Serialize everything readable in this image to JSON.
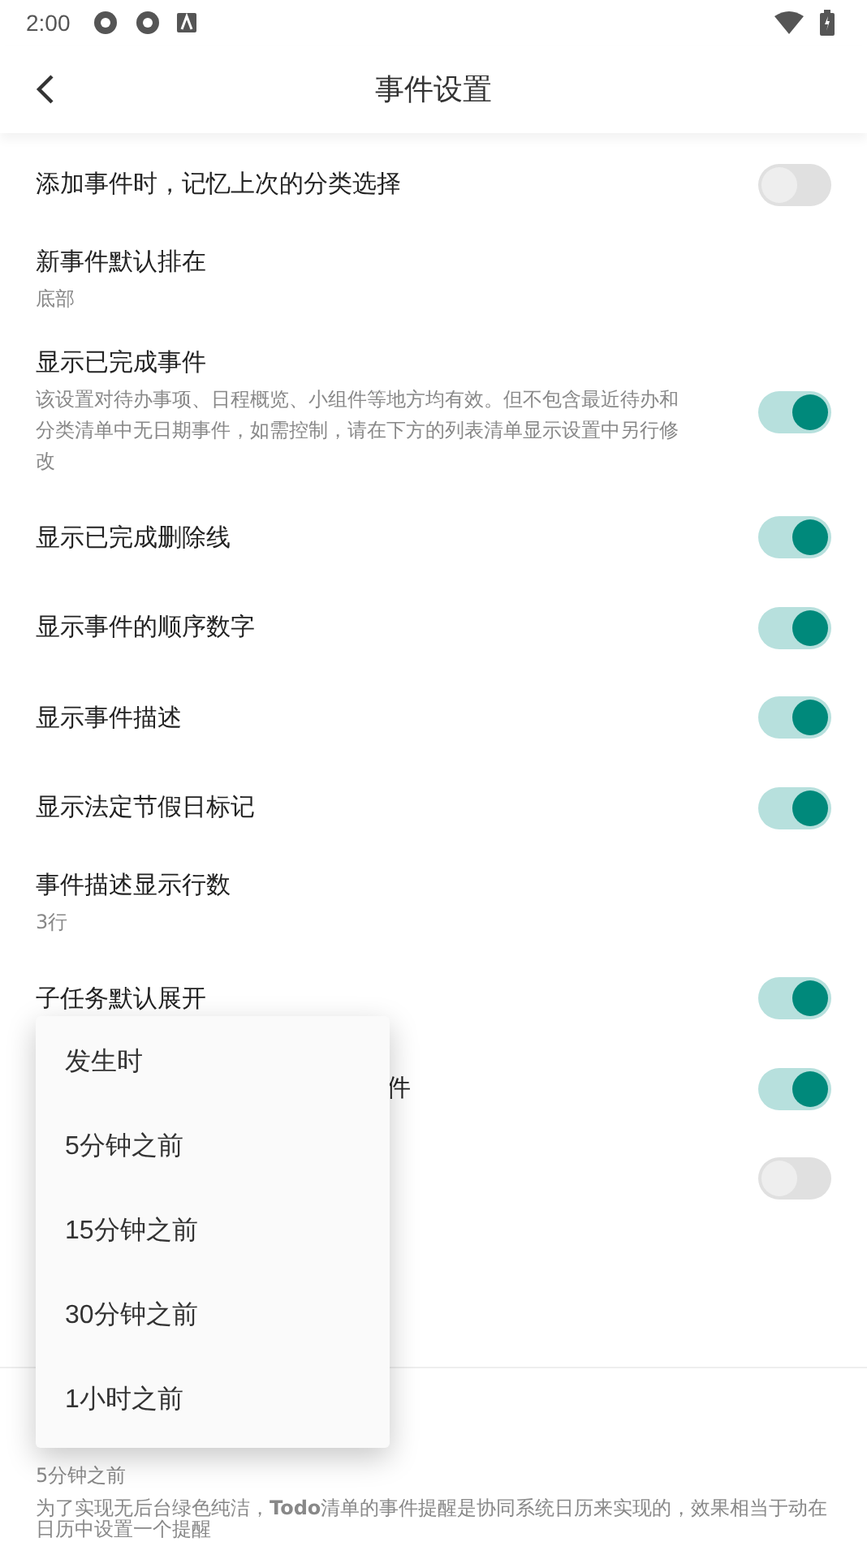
{
  "status_bar": {
    "time": "2:00"
  },
  "header": {
    "title": "事件设置"
  },
  "settings": [
    {
      "kind": "switch",
      "title": "添加事件时，记忆上次的分类选择",
      "on": false
    },
    {
      "kind": "value",
      "title": "新事件默认排在",
      "subtitle": "底部"
    },
    {
      "kind": "switch",
      "title": "显示已完成事件",
      "subtitle": "该设置对待办事项、日程概览、小组件等地方均有效。但不包含最近待办和分类清单中无日期事件，如需控制，请在下方的列表清单显示设置中另行修改",
      "on": true
    },
    {
      "kind": "switch",
      "title": "显示已完成删除线",
      "on": true
    },
    {
      "kind": "switch",
      "title": "显示事件的顺序数字",
      "on": true
    },
    {
      "kind": "switch",
      "title": "显示事件描述",
      "on": true
    },
    {
      "kind": "switch",
      "title": "显示法定节假日标记",
      "on": true
    },
    {
      "kind": "value",
      "title": "事件描述显示行数",
      "subtitle": "3行"
    },
    {
      "kind": "switch",
      "title": "子任务默认展开",
      "on": true
    },
    {
      "kind": "switch",
      "title": "件",
      "covered": true,
      "on": true
    },
    {
      "kind": "switch",
      "on": false
    }
  ],
  "reminder": {
    "subtitle": "5分钟之前",
    "description": "为了实现无后台绿色纯洁，**Todo**清单的事件提醒是协同系统日历来实现的，效果相当于动在日历中设置一个提醒"
  },
  "menu": {
    "items": [
      {
        "label": "发生时"
      },
      {
        "label": "5分钟之前"
      },
      {
        "label": "15分钟之前"
      },
      {
        "label": "30分钟之前"
      },
      {
        "label": "1小时之前"
      }
    ]
  }
}
